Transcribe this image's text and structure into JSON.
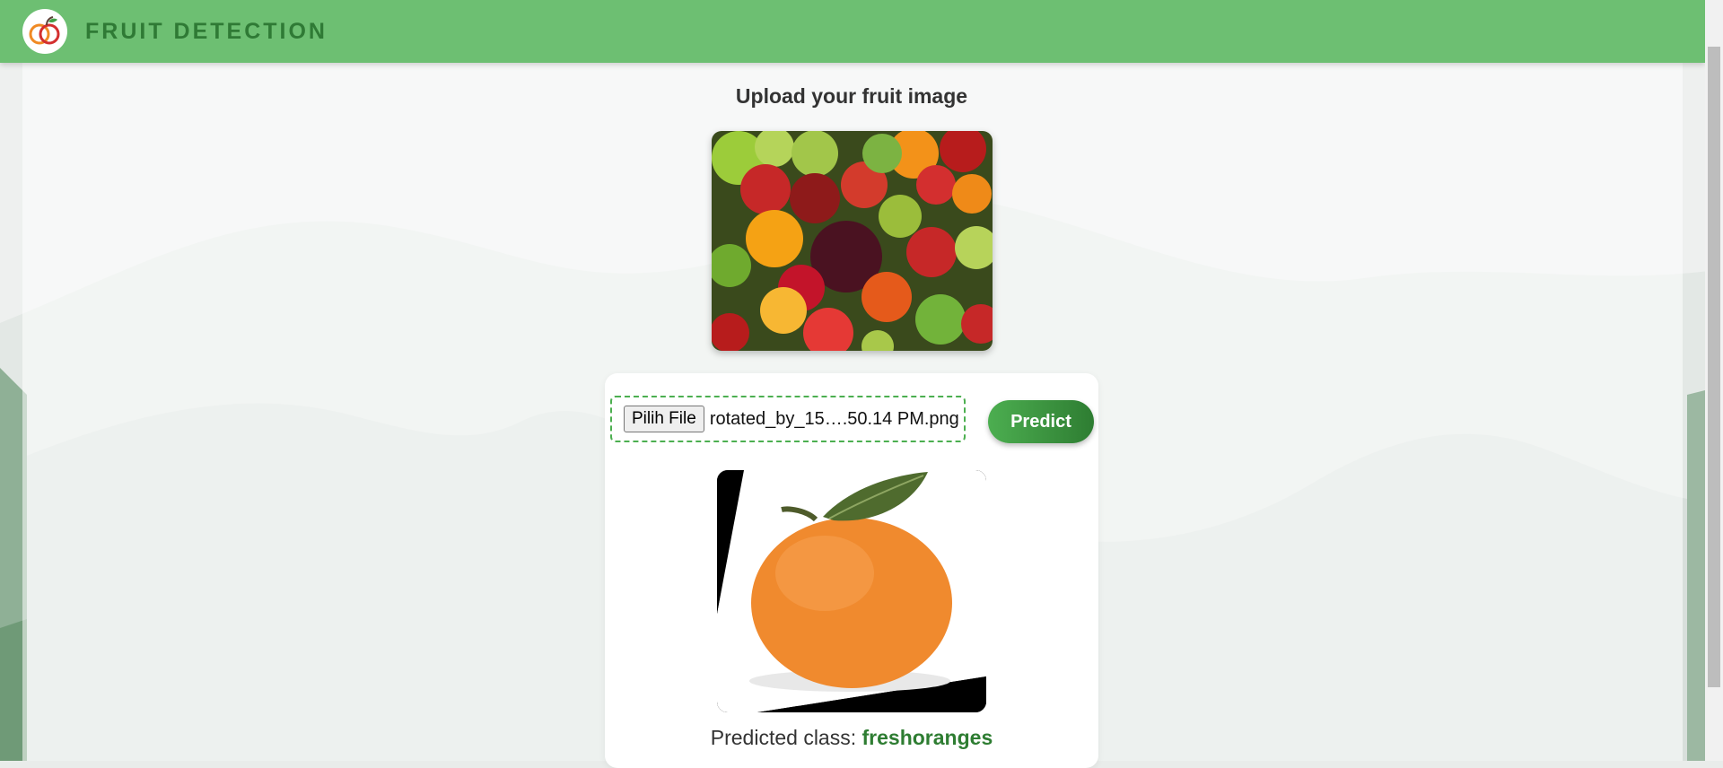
{
  "header": {
    "brand": "FRUIT DETECTION",
    "logo_icon": "fruit-logo-icon"
  },
  "upload": {
    "title": "Upload your fruit image",
    "preview_icon": "fruit-mix-image"
  },
  "form": {
    "file_button_label": "Pilih File",
    "file_name": "rotated_by_15….50.14 PM.png",
    "predict_label": "Predict"
  },
  "result": {
    "image_icon": "orange-image",
    "label": "Predicted class:",
    "value": "freshoranges"
  },
  "colors": {
    "header": "#6dbf72",
    "brand": "#2f7a35",
    "accent": "#2e7d32"
  }
}
